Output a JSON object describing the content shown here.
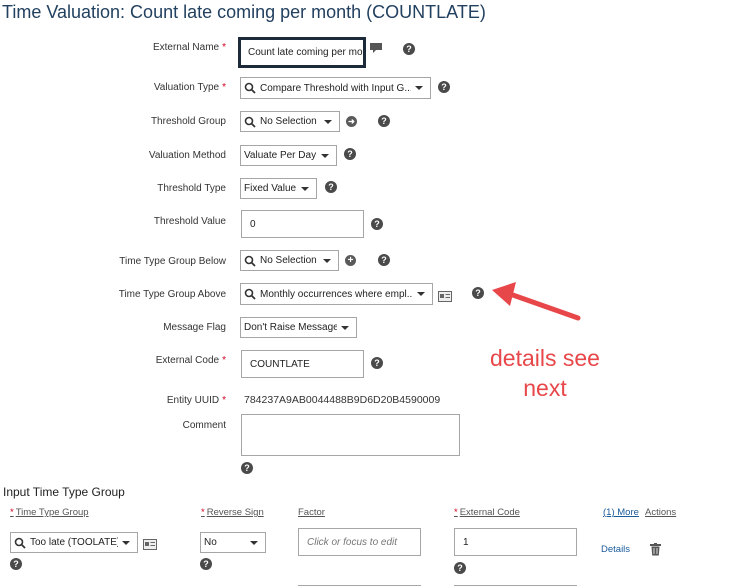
{
  "page_title": "Time Valuation: Count late coming per month (COUNTLATE)",
  "form": {
    "external_name": {
      "label": "External Name",
      "value": "Count late coming per month"
    },
    "valuation_type": {
      "label": "Valuation Type",
      "value": "Compare Threshold with Input G..."
    },
    "threshold_group": {
      "label": "Threshold Group",
      "value": "No Selection"
    },
    "valuation_method": {
      "label": "Valuation Method",
      "value": "Valuate Per Day"
    },
    "threshold_type": {
      "label": "Threshold Type",
      "value": "Fixed Value"
    },
    "threshold_value": {
      "label": "Threshold Value",
      "value": "0"
    },
    "time_type_group_below": {
      "label": "Time Type Group Below",
      "value": "No Selection"
    },
    "time_type_group_above": {
      "label": "Time Type Group Above",
      "value": "Monthly occurrences where empl..."
    },
    "message_flag": {
      "label": "Message Flag",
      "value": "Don't Raise Message"
    },
    "external_code": {
      "label": "External Code",
      "value": "COUNTLATE"
    },
    "entity_uuid": {
      "label": "Entity UUID",
      "value": "784237A9AB0044488B9D6D20B4590009"
    },
    "comment": {
      "label": "Comment",
      "value": ""
    },
    "required_mark": "*"
  },
  "annotation": {
    "line1": "details see",
    "line2": "next",
    "color": "#e8474a"
  },
  "input_group": {
    "title": "Input Time Type Group",
    "headers": {
      "time_type_group": "Time Type Group",
      "reverse_sign": "Reverse Sign",
      "factor": "Factor",
      "external_code": "External Code",
      "more": "(1) More",
      "actions": "Actions"
    },
    "row": {
      "time_type_group": "Too late (TOOLATE)",
      "reverse_sign": "No",
      "factor_placeholder": "Click or focus to edit",
      "external_code": "1",
      "details": "Details"
    }
  },
  "icons": {
    "help": "help-circle-icon",
    "search": "search-icon",
    "add": "plus-circle-icon",
    "card": "details-card-icon",
    "delete": "trash-icon"
  },
  "colors": {
    "title": "#22405f",
    "link": "#1a5b9a",
    "required": "#d0021b"
  }
}
